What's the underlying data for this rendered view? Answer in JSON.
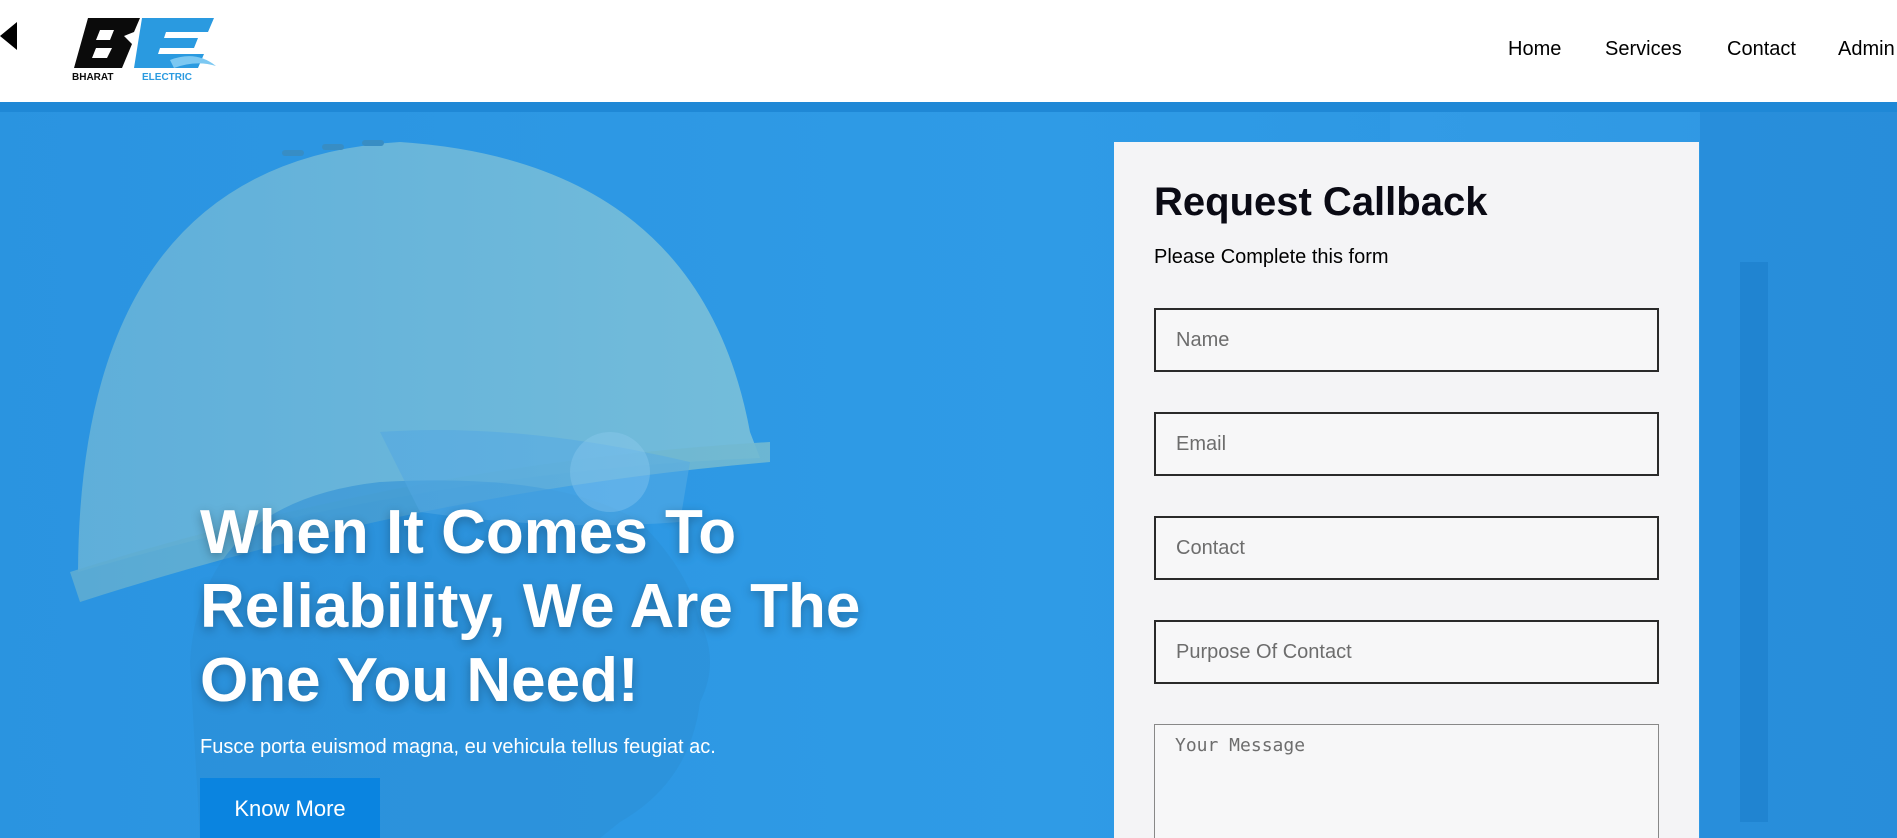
{
  "header": {
    "logo": {
      "text_top": "BE",
      "brand_word_1": "BHARAT",
      "brand_word_2": "ELECTRIC"
    },
    "nav": [
      {
        "label": "Home"
      },
      {
        "label": "Services"
      },
      {
        "label": "Contact"
      },
      {
        "label": "Admin"
      }
    ],
    "back_icon": "back-arrow-icon"
  },
  "hero": {
    "title": "When It Comes To Reliability, We Are The One You Need!",
    "subtitle": "Fusce porta euismod magna, eu vehicula tellus feugiat ac.",
    "cta_label": "Know More",
    "background_color": "#2f9be6",
    "button_color": "#0a84e0"
  },
  "callback_form": {
    "title": "Request Callback",
    "subtitle": "Please Complete this form",
    "fields": [
      {
        "placeholder": "Name",
        "value": ""
      },
      {
        "placeholder": "Email",
        "value": ""
      },
      {
        "placeholder": "Contact",
        "value": ""
      },
      {
        "placeholder": "Purpose Of Contact",
        "value": ""
      }
    ],
    "message_placeholder": "Your Message"
  }
}
